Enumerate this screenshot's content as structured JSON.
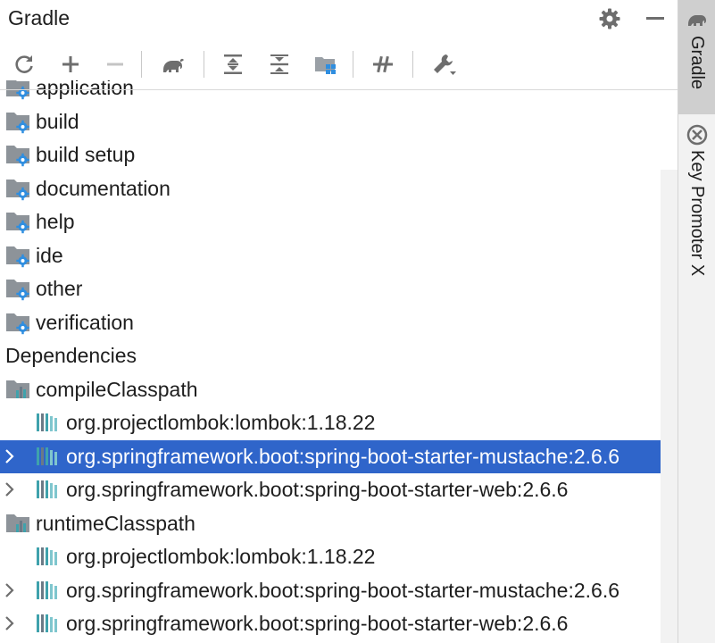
{
  "header": {
    "title": "Gradle"
  },
  "toolbar": {
    "buttons": [
      "reload-icon",
      "plus-icon",
      "minus-icon",
      "elephant-icon",
      "expand-all-icon",
      "collapse-all-icon",
      "group-modules-icon",
      "toggle-offline-icon",
      "settings-wrench-icon"
    ]
  },
  "tree": {
    "partial_label": "application",
    "task_groups": [
      "build",
      "build setup",
      "documentation",
      "help",
      "ide",
      "other",
      "verification"
    ],
    "dependencies_label": "Dependencies",
    "compile": {
      "label": "compileClasspath",
      "items": [
        "org.projectlombok:lombok:1.18.22",
        "org.springframework.boot:spring-boot-starter-mustache:2.6.6",
        "org.springframework.boot:spring-boot-starter-web:2.6.6"
      ]
    },
    "runtime": {
      "label": "runtimeClasspath",
      "items": [
        "org.projectlombok:lombok:1.18.22",
        "org.springframework.boot:spring-boot-starter-mustache:2.6.6",
        "org.springframework.boot:spring-boot-starter-web:2.6.6"
      ]
    },
    "selected_item": "org.springframework.boot:spring-boot-starter-mustache:2.6.6"
  },
  "side": {
    "gradle_tab": "Gradle",
    "key_promoter_tab": "Key Promoter X"
  },
  "colors": {
    "selection": "#2f65ca",
    "folder": "#8d9399",
    "gear": "#2f8ee0",
    "lib_teal": "#3fa2ac"
  }
}
